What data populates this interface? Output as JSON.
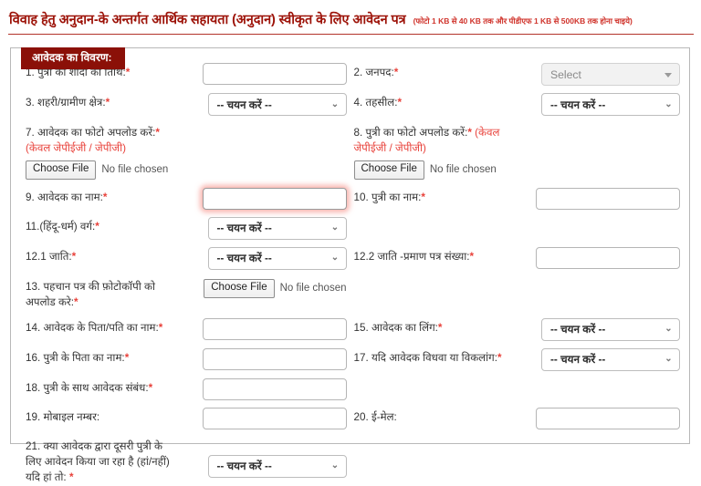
{
  "header": {
    "title": "विवाह हेतु अनुदान-के अन्तर्गत आर्थिक सहायता (अनुदान) स्वीकृत के लिए आवेदन पत्र",
    "note": "(फोटो 1 KB से 40 KB तक और पीडीएफ 1 KB से 500KB तक होना चाइये)"
  },
  "section": {
    "legend": "आवेदक का विवरण:"
  },
  "common": {
    "select_placeholder": "-- चयन करें --",
    "choose_file": "Choose File",
    "no_file": "No file chosen",
    "chevron": "⌄",
    "required_mark": "*"
  },
  "fields": {
    "f1": {
      "label": "1. पुत्री की शादी की तिथि:",
      "value": ""
    },
    "f2": {
      "label": "2. जनपद:",
      "value": "Select"
    },
    "f3": {
      "label": "3. शहरी/ग्रामीण क्षेत्र:",
      "value": "-- चयन करें --"
    },
    "f4": {
      "label": "4. तहसील:",
      "value": "-- चयन करें --"
    },
    "f7": {
      "label": "7. आवेदक का फोटो अपलोड करें:",
      "note": "(केवल जेपीईजी / जेपीजी)",
      "btn": "Choose File",
      "status": "No file chosen"
    },
    "f8": {
      "label": "8. पुत्री का फोटो अपलोड करें:",
      "note_a": "(केवल",
      "note_b": "जेपीईजी / जेपीजी)",
      "btn": "Choose File",
      "status": "No file chosen"
    },
    "f9": {
      "label": "9. आवेदक का नाम:",
      "value": ""
    },
    "f10": {
      "label": "10. पुत्री का नाम:",
      "value": ""
    },
    "f11": {
      "label": "11.(हिंदू-धर्म) वर्ग:",
      "value": "-- चयन करें --"
    },
    "f121": {
      "label": "12.1 जाति:",
      "value": "-- चयन करें --"
    },
    "f122": {
      "label": "12.2 जाति -प्रमाण पत्र संख्या:",
      "value": ""
    },
    "f13": {
      "label_a": "13. पहचान पत्र की फ़ोटोकॉपी को",
      "label_b": "अपलोड करे:",
      "btn": "Choose File",
      "status": "No file chosen"
    },
    "f14": {
      "label": "14. आवेदक के पिता/पति का नाम:",
      "value": ""
    },
    "f15": {
      "label": "15. आवेदक का लिंग:",
      "value": "-- चयन करें --"
    },
    "f16": {
      "label": "16. पुत्री के पिता का नाम:",
      "value": ""
    },
    "f17": {
      "label": "17. यदि आवेदक विधवा या विकलांग:",
      "value": "-- चयन करें --"
    },
    "f18": {
      "label": "18. पुत्री के साथ आवेदक संबंध:",
      "value": ""
    },
    "f19": {
      "label": "19. मोबाइल नम्बर:",
      "value": ""
    },
    "f20": {
      "label": "20. ई-मेल:",
      "value": ""
    },
    "f21": {
      "label_a": "21. क्या आवेदक द्वारा दूसरी पुत्री के",
      "label_b": "लिए आवेदन किया जा रहा है (हां/नहीं)",
      "label_c": "यदि हां तो:",
      "value": "-- चयन करें --"
    }
  },
  "colors": {
    "title": "#9d1309",
    "note": "#d0342c",
    "legend_bg": "#8b1008",
    "required": "#e8413a",
    "focus_glow": "#f4786e"
  }
}
